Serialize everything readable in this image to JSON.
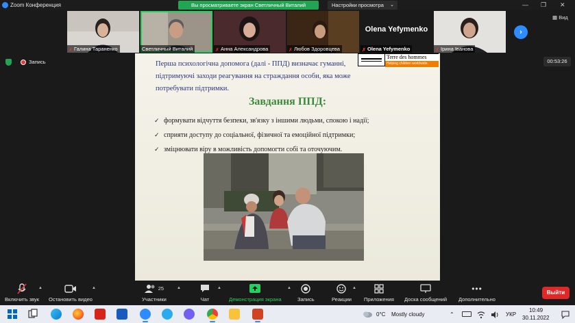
{
  "window": {
    "title": "Zoom Конференция",
    "banner": "Вы просматриваете экран Светличный Виталий",
    "view_settings": "Настройки просмотра",
    "view_button": "Вид"
  },
  "participants": [
    {
      "name": "Галина Тараненко",
      "muted": true
    },
    {
      "name": "Светличный Виталий",
      "muted": false
    },
    {
      "name": "Анна Александрова",
      "muted": true
    },
    {
      "name": "Любов Здоровцева",
      "muted": true
    },
    {
      "name": "Olena Yefymenko",
      "muted": true,
      "display_text": "Olena Yefymenko"
    },
    {
      "name": "Ірина Іванова",
      "muted": true
    }
  ],
  "status": {
    "recording_label": "Запись",
    "timer": "00:53:26"
  },
  "slide": {
    "intro": "Перша психологічна допомога (далі - ППД) визначає гуманні, підтримуючі заходи реагування на страждання особи, яка може потребувати підтримки.",
    "logo_name": "Terre des hommes",
    "logo_tagline": "Helping children worldwide.",
    "heading": "Завдання ППД:",
    "tasks": [
      "формувати відчуття безпеки, зв'язку з іншими людьми, спокою і надії;",
      "сприяти доступу до соціальної, фізичної та емоційної підтримки;",
      "зміцнювати віру в можливість допомогти собі та оточуючим."
    ]
  },
  "toolbar": {
    "mic": "Включить звук",
    "video": "Остановить видео",
    "participants": "Участники",
    "participants_count": "25",
    "chat": "Чат",
    "share": "Демонстрация экрана",
    "record": "Запись",
    "reactions": "Реакции",
    "apps": "Приложения",
    "whiteboards": "Доска сообщений",
    "more": "Дополнительно",
    "exit": "Выйти"
  },
  "taskbar": {
    "weather_temp": "0°C",
    "weather_desc": "Mostly cloudy",
    "language": "УКР",
    "time": "10:49",
    "date": "30.11.2022"
  },
  "colors": {
    "zoom_blue": "#2d8cff",
    "banner_green": "#23a455",
    "exit_red": "#e02828",
    "slide_text_blue": "#2a3580",
    "heading_green": "#3a8a3a",
    "tdh_orange": "#f07d00"
  }
}
